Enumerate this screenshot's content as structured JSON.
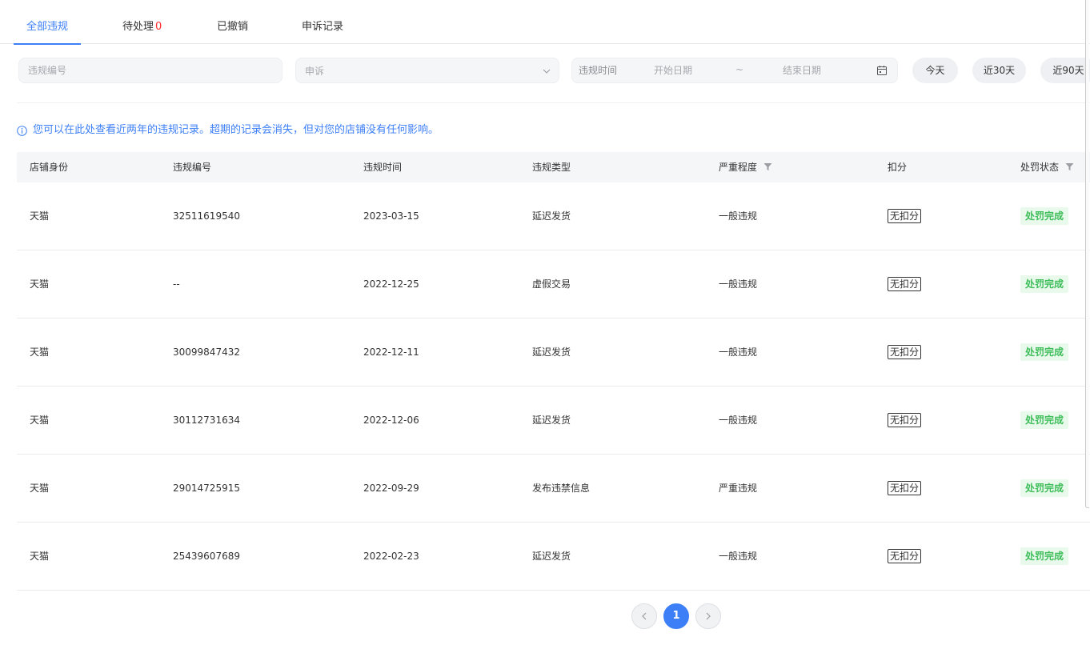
{
  "tabs": [
    {
      "label": "全部违规",
      "active": true
    },
    {
      "label": "待处理",
      "count": "0"
    },
    {
      "label": "已撤销"
    },
    {
      "label": "申诉记录"
    }
  ],
  "filters": {
    "violation_no_placeholder": "违规编号",
    "appeal_select_value": "申诉",
    "date_label": "违规时间",
    "date_start_placeholder": "开始日期",
    "date_separator": "~",
    "date_end_placeholder": "结束日期",
    "quick_today": "今天",
    "quick_30": "近30天",
    "quick_90": "近90天"
  },
  "notice": "您可以在此处查看近两年的违规记录。超期的记录会消失，但对您的店铺没有任何影响。",
  "table": {
    "headers": [
      "店铺身份",
      "违规编号",
      "违规时间",
      "违规类型",
      "严重程度",
      "扣分",
      "处罚状态"
    ],
    "rows": [
      [
        "天猫",
        "32511619540",
        "2023-03-15",
        "延迟发货",
        "一般违规",
        "无扣分",
        "处罚完成"
      ],
      [
        "天猫",
        "--",
        "2022-12-25",
        "虚假交易",
        "一般违规",
        "无扣分",
        "处罚完成"
      ],
      [
        "天猫",
        "30099847432",
        "2022-12-11",
        "延迟发货",
        "一般违规",
        "无扣分",
        "处罚完成"
      ],
      [
        "天猫",
        "30112731634",
        "2022-12-06",
        "延迟发货",
        "一般违规",
        "无扣分",
        "处罚完成"
      ],
      [
        "天猫",
        "29014725915",
        "2022-09-29",
        "发布违禁信息",
        "严重违规",
        "无扣分",
        "处罚完成"
      ],
      [
        "天猫",
        "25439607689",
        "2022-02-23",
        "延迟发货",
        "一般违规",
        "无扣分",
        "处罚完成"
      ]
    ]
  },
  "pagination": {
    "current": "1"
  },
  "colors": {
    "accent": "#3d7ff6",
    "danger": "#ff2b2b",
    "success": "#3fbe5b"
  },
  "icons": [
    "chevron-down-icon",
    "calendar-icon",
    "info-icon",
    "filter-icon",
    "chevron-left-icon",
    "chevron-right-icon"
  ]
}
